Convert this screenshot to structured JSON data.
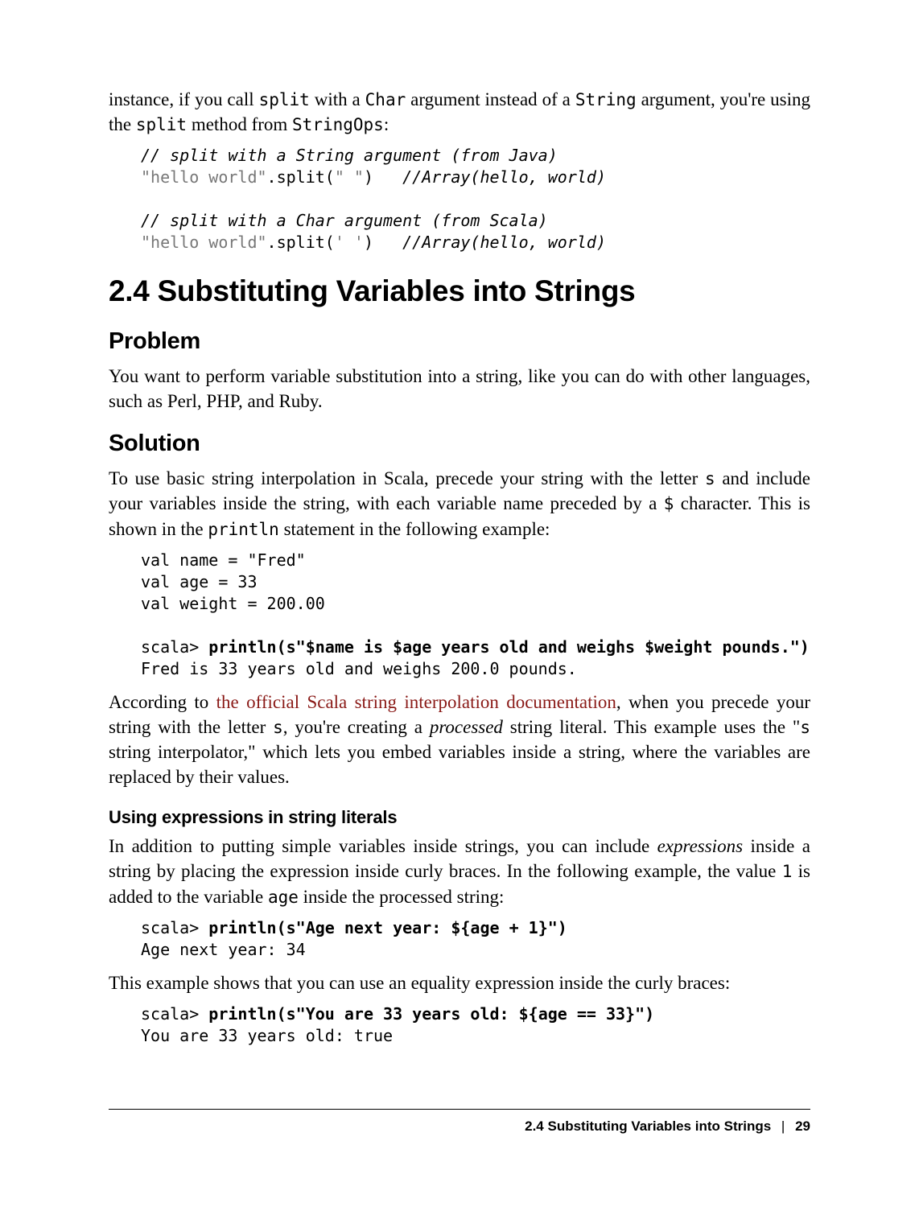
{
  "intro": {
    "p1_a": "instance, if you call ",
    "p1_code1": "split",
    "p1_b": " with a ",
    "p1_code2": "Char",
    "p1_c": " argument instead of a ",
    "p1_code3": "String",
    "p1_d": " argument, you're using the ",
    "p1_code4": "split",
    "p1_e": " method from ",
    "p1_code5": "StringOps",
    "p1_f": ":"
  },
  "code1": {
    "l1": "// split with a String argument (from Java)",
    "l2a": "\"hello world\"",
    "l2b": ".split(",
    "l2c": "\" \"",
    "l2d": ")   ",
    "l2e": "//Array(hello, world)",
    "l3": "",
    "l4": "// split with a Char argument (from Scala)",
    "l5a": "\"hello world\"",
    "l5b": ".split(",
    "l5c": "' '",
    "l5d": ")   ",
    "l5e": "//Array(hello, world)"
  },
  "section_title": "2.4 Substituting Variables into Strings",
  "problem": {
    "heading": "Problem",
    "p": "You want to perform variable substitution into a string, like you can do with other languages, such as Perl, PHP, and Ruby."
  },
  "solution": {
    "heading": "Solution",
    "p1_a": "To use basic string interpolation in Scala, precede your string with the letter ",
    "p1_code1": "s",
    "p1_b": " and include your variables inside the string, with each variable name preceded by a ",
    "p1_code2": "$",
    "p1_c": " character. This is shown in the ",
    "p1_code3": "println",
    "p1_d": " statement in the following example:"
  },
  "code2": {
    "l1": "val name = \"Fred\"",
    "l2": "val age = 33",
    "l3": "val weight = 200.00",
    "l4": "",
    "l5a": "scala> ",
    "l5b": "println(s\"$name is $age years old and weighs $weight pounds.\")",
    "l6": "Fred is 33 years old and weighs 200.0 pounds."
  },
  "after_code2": {
    "a": "According to ",
    "link": "the official Scala string interpolation documentation",
    "b": ", when you precede your string with the letter ",
    "code1": "s",
    "c": ", you're creating a ",
    "em1": "processed",
    "d": " string literal. This example uses the \"",
    "code2": "s",
    "e": " string interpolator,\" which lets you embed variables inside a string, where the variables are replaced by their values."
  },
  "expr": {
    "heading": "Using expressions in string literals",
    "p1_a": "In addition to putting simple variables inside strings, you can include ",
    "p1_em": "expressions",
    "p1_b": " inside a string by placing the expression inside curly braces. In the following example, the value ",
    "p1_code1": "1",
    "p1_c": " is added to the variable ",
    "p1_code2": "age",
    "p1_d": " inside the processed string:"
  },
  "code3": {
    "l1a": "scala> ",
    "l1b": "println(s\"Age next year: ${age + 1}\")",
    "l2": "Age next year: 34"
  },
  "after_code3": "This example shows that you can use an equality expression inside the curly braces:",
  "code4": {
    "l1a": "scala> ",
    "l1b": "println(s\"You are 33 years old: ${age == 33}\")",
    "l2": "You are 33 years old: true"
  },
  "footer": {
    "title": "2.4 Substituting Variables into Strings",
    "sep": "|",
    "page": "29"
  }
}
